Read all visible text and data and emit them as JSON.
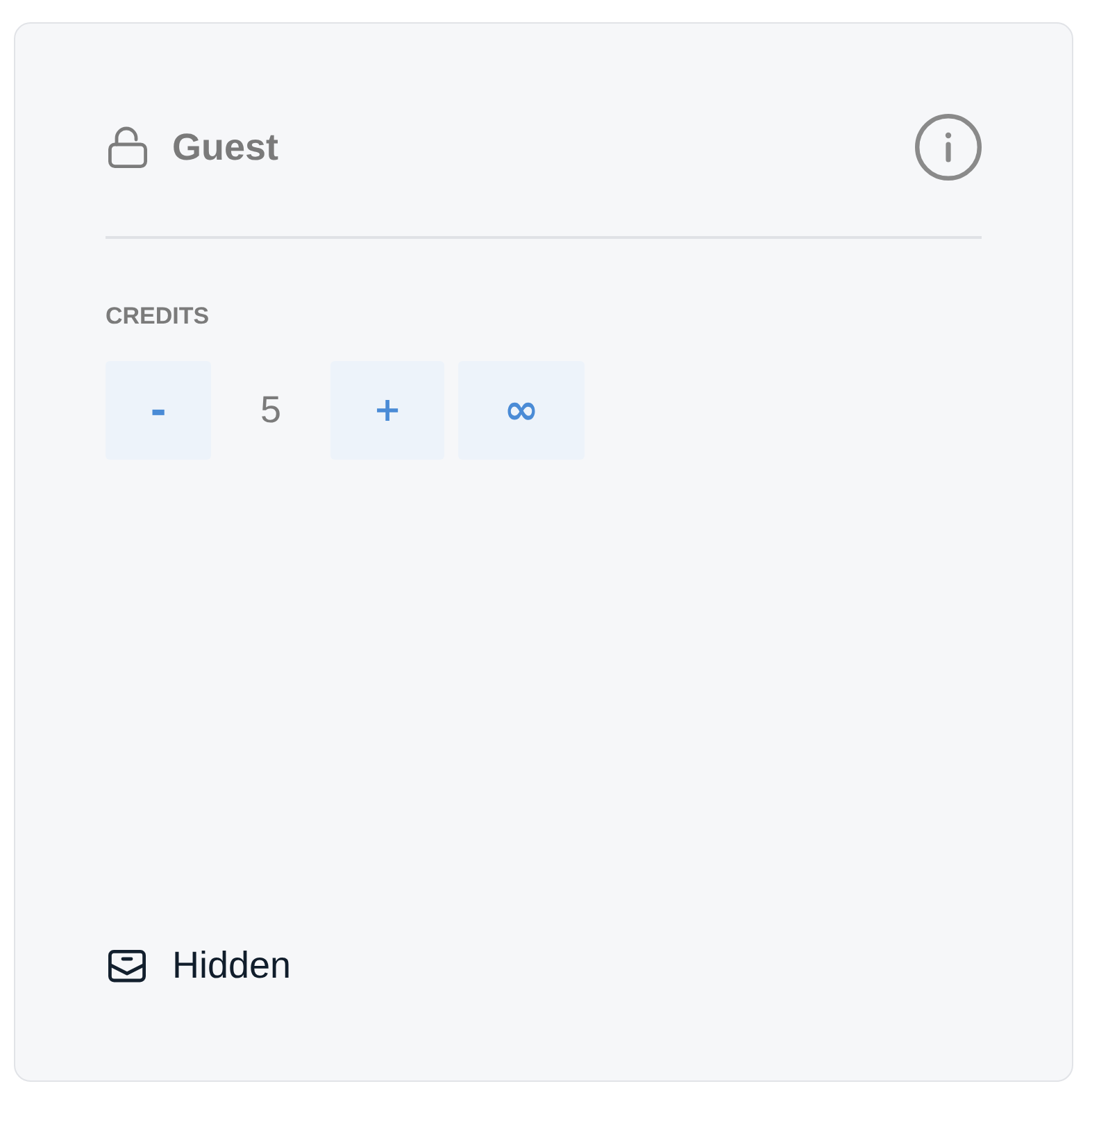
{
  "header": {
    "title": "Guest"
  },
  "credits": {
    "label": "CREDITS",
    "decrement": "-",
    "value": "5",
    "increment": "+",
    "unlimited": "∞"
  },
  "footer": {
    "label": "Hidden"
  }
}
